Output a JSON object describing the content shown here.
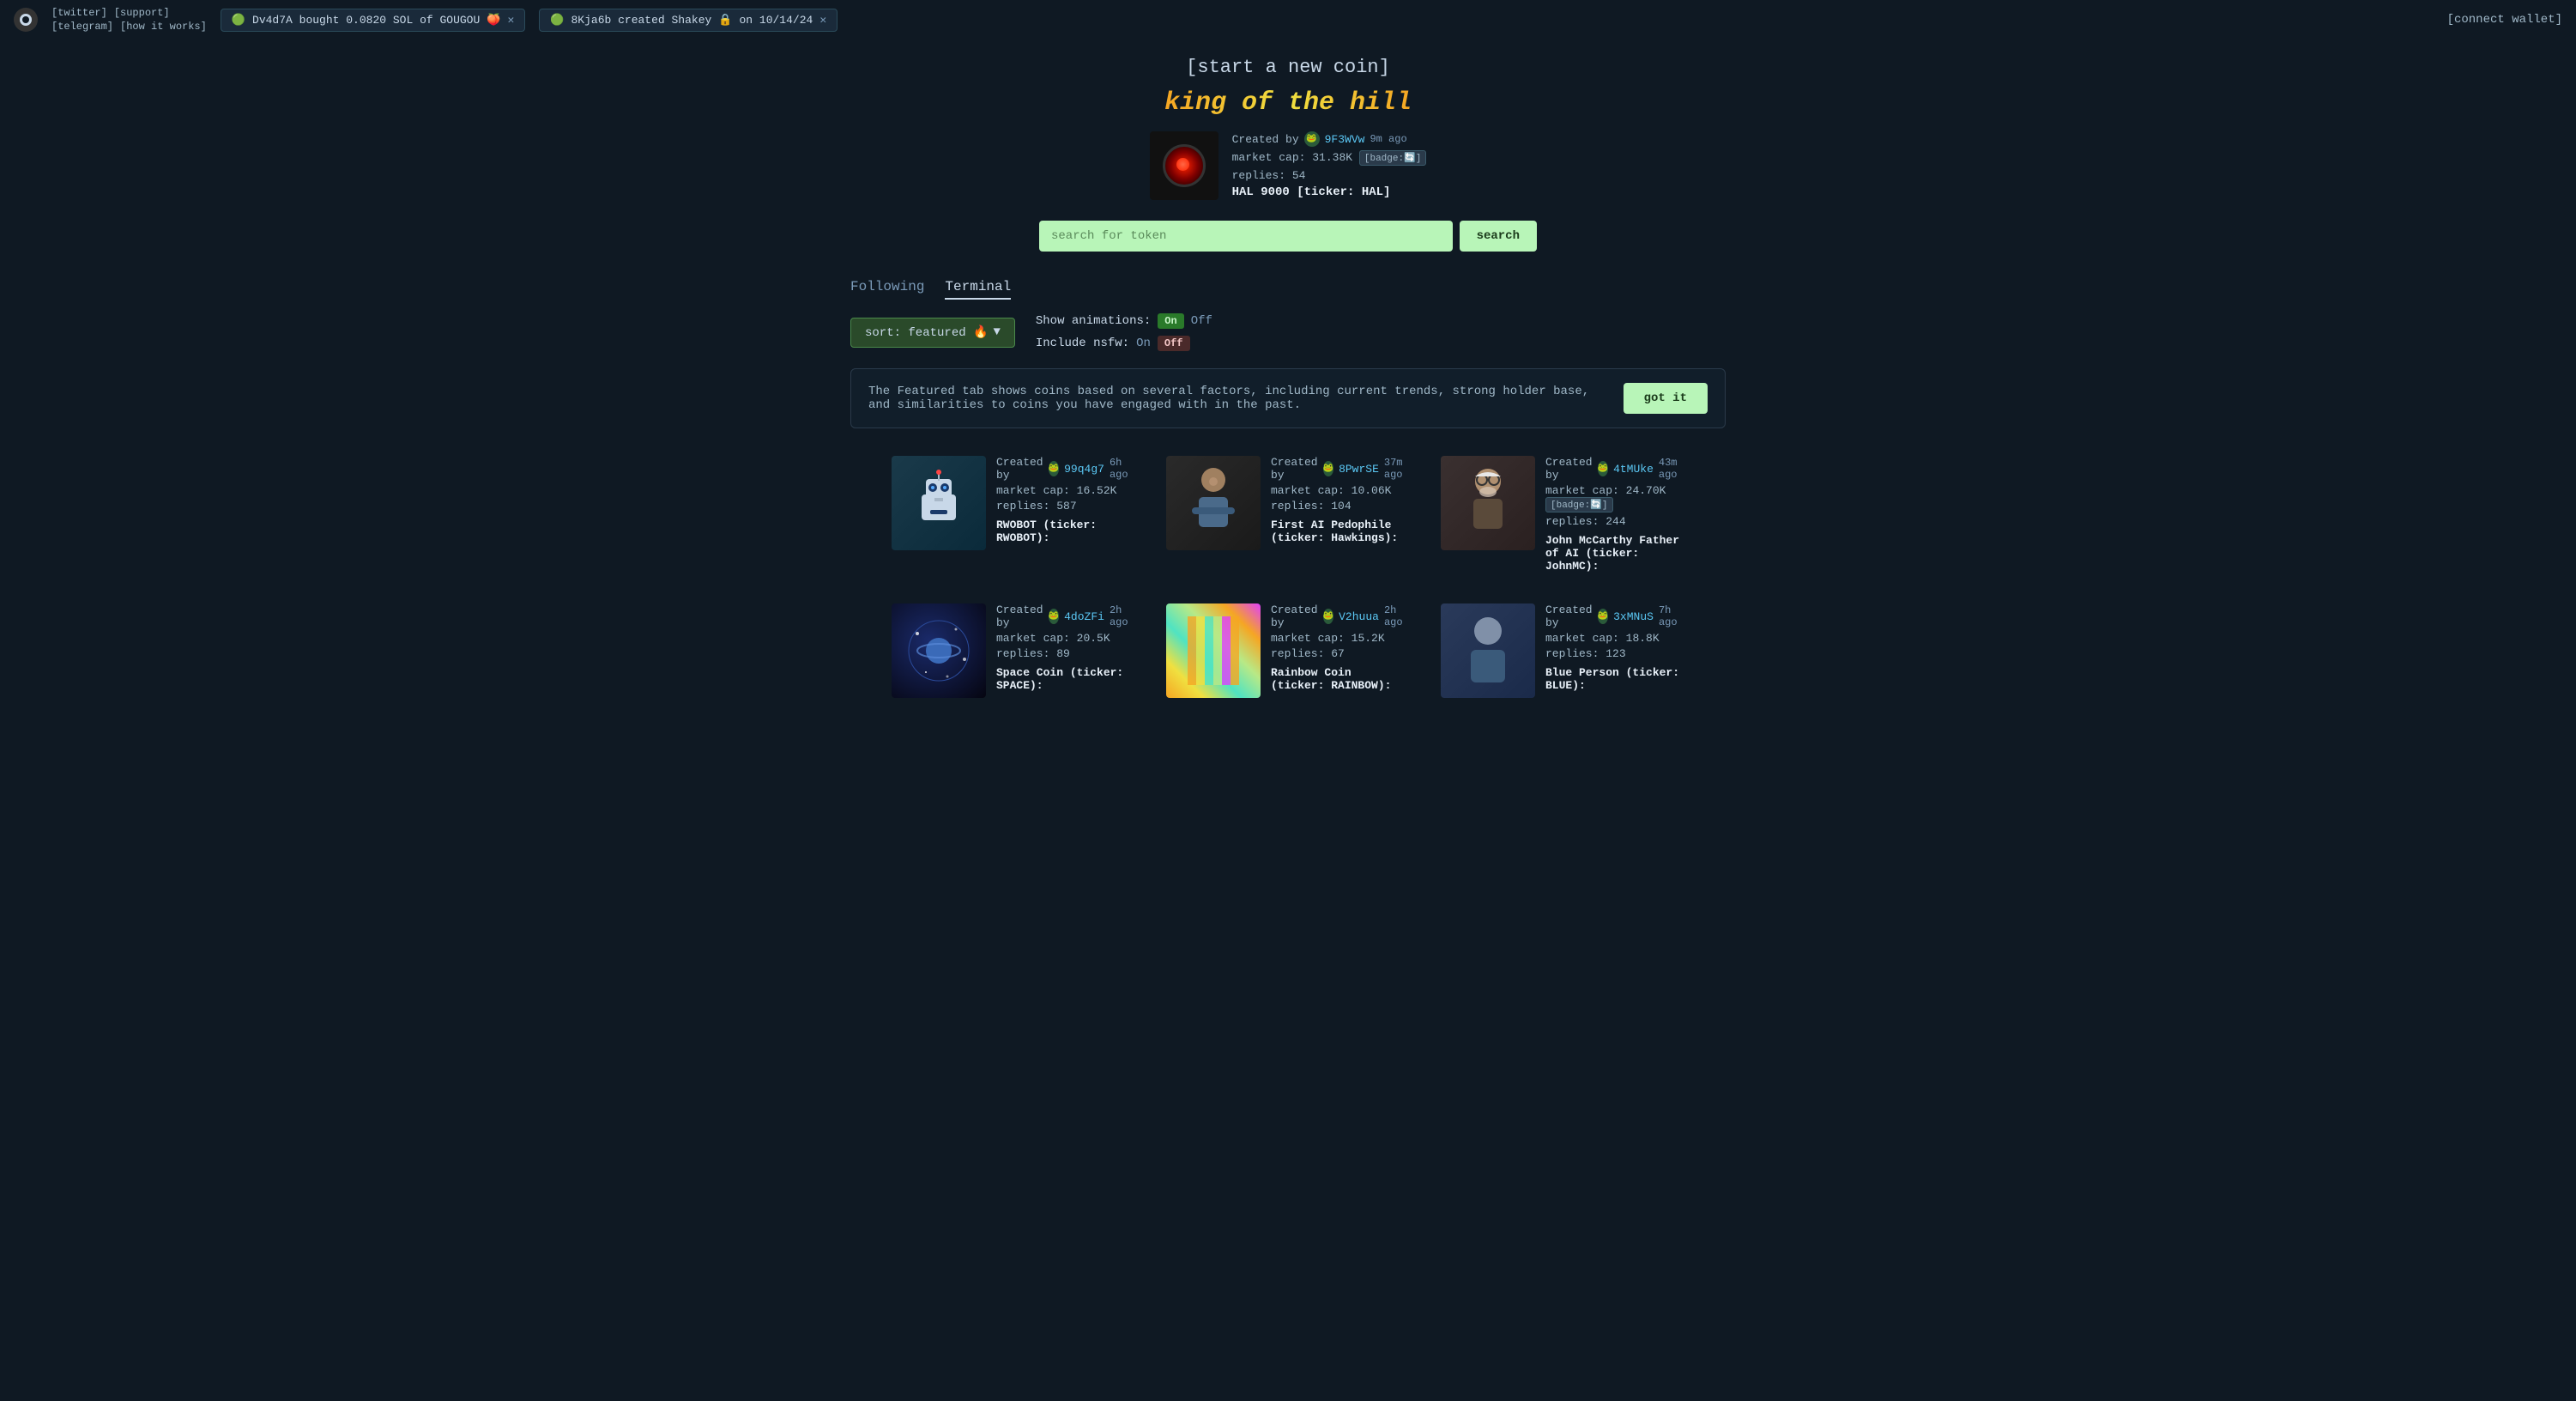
{
  "topbar": {
    "logo_alt": "pump.fun logo",
    "links": [
      {
        "label": "[twitter]",
        "id": "twitter-link"
      },
      {
        "label": "[support]",
        "id": "support-link"
      },
      {
        "label": "[telegram]",
        "id": "telegram-link"
      },
      {
        "label": "[how it works]",
        "id": "how-it-works-link"
      }
    ],
    "tickers": [
      {
        "id": "ticker-1",
        "text": "Dv4d7A  bought 0.0820 SOL of GOUGOU",
        "emoji": "🟢",
        "coin_emoji": "🍑"
      },
      {
        "id": "ticker-2",
        "text": "8Kja6b created Shakey",
        "emoji": "🟢",
        "date": "on 10/14/24",
        "coin_emoji": "🔒"
      }
    ],
    "connect_wallet_label": "[connect wallet]"
  },
  "hero": {
    "start_coin_label": "[start a new coin]",
    "king_banner": "king of the hill",
    "featured_coin": {
      "created_by_label": "Created by",
      "creator": "9F3WVw",
      "time_ago": "9m ago",
      "market_cap_label": "market cap:",
      "market_cap_value": "31.38K",
      "badge_label": "[badge:🔄]",
      "replies_label": "replies:",
      "replies_count": "54",
      "coin_name": "HAL 9000 [ticker: HAL]"
    }
  },
  "search": {
    "placeholder": "search for token",
    "button_label": "search"
  },
  "tabs": [
    {
      "label": "Following",
      "active": false
    },
    {
      "label": "Terminal",
      "active": true
    }
  ],
  "controls": {
    "sort_label": "sort: featured 🔥",
    "sort_chevron": "▼",
    "show_animations_label": "Show animations:",
    "show_animations_on": "On",
    "show_animations_off": "Off",
    "show_animations_state": "on",
    "include_nsfw_label": "Include nsfw:",
    "include_nsfw_on": "On",
    "include_nsfw_off": "Off",
    "include_nsfw_state": "off"
  },
  "featured_notice": {
    "text": "The Featured tab shows coins based on several factors, including current trends, strong holder base, and similarities to coins you have engaged with in the past.",
    "button_label": "got it"
  },
  "coins": [
    {
      "id": "coin-1",
      "created_by": "Created by",
      "creator": "99q4g7",
      "time_ago": "6h ago",
      "market_cap_label": "market cap:",
      "market_cap": "16.52K",
      "replies_label": "replies:",
      "replies": "587",
      "name": "RWOBOT (ticker: RWOBOT):",
      "thumb_type": "robot",
      "has_badge": false
    },
    {
      "id": "coin-2",
      "created_by": "Created by",
      "creator": "8PwrSE",
      "time_ago": "37m ago",
      "market_cap_label": "market cap:",
      "market_cap": "10.06K",
      "replies_label": "replies:",
      "replies": "104",
      "name": "First AI Pedophile (ticker: Hawkings):",
      "thumb_type": "hawking",
      "has_badge": false
    },
    {
      "id": "coin-3",
      "created_by": "Created by",
      "creator": "4tMUke",
      "time_ago": "43m ago",
      "market_cap_label": "market cap:",
      "market_cap": "24.70K",
      "badge_label": "[badge:🔄]",
      "replies_label": "replies:",
      "replies": "244",
      "name": "John McCarthy Father of AI (ticker: JohnMC):",
      "thumb_type": "mccarthy",
      "has_badge": true
    },
    {
      "id": "coin-4",
      "created_by": "Created by",
      "creator": "4doZFi",
      "time_ago": "2h ago",
      "market_cap_label": "market cap:",
      "market_cap": "20.5K",
      "replies_label": "replies:",
      "replies": "89",
      "name": "Space Coin (ticker: SPACE):",
      "thumb_type": "space",
      "has_badge": false
    },
    {
      "id": "coin-5",
      "created_by": "Created by",
      "creator": "V2huua",
      "time_ago": "2h ago",
      "market_cap_label": "market cap:",
      "market_cap": "15.2K",
      "replies_label": "replies:",
      "replies": "67",
      "name": "Rainbow Coin (ticker: RAINBOW):",
      "thumb_type": "colorful",
      "has_badge": false
    },
    {
      "id": "coin-6",
      "created_by": "Created by",
      "creator": "3xMNuS",
      "time_ago": "7h ago",
      "market_cap_label": "market cap:",
      "market_cap": "18.8K",
      "replies_label": "replies:",
      "replies": "123",
      "name": "Blue Person (ticker: BLUE):",
      "thumb_type": "person",
      "has_badge": false
    }
  ],
  "colors": {
    "accent_green": "#b8f5b8",
    "bg_dark": "#0f1923",
    "text_muted": "#7a9ab8",
    "text_bright": "#e8f0f8"
  }
}
